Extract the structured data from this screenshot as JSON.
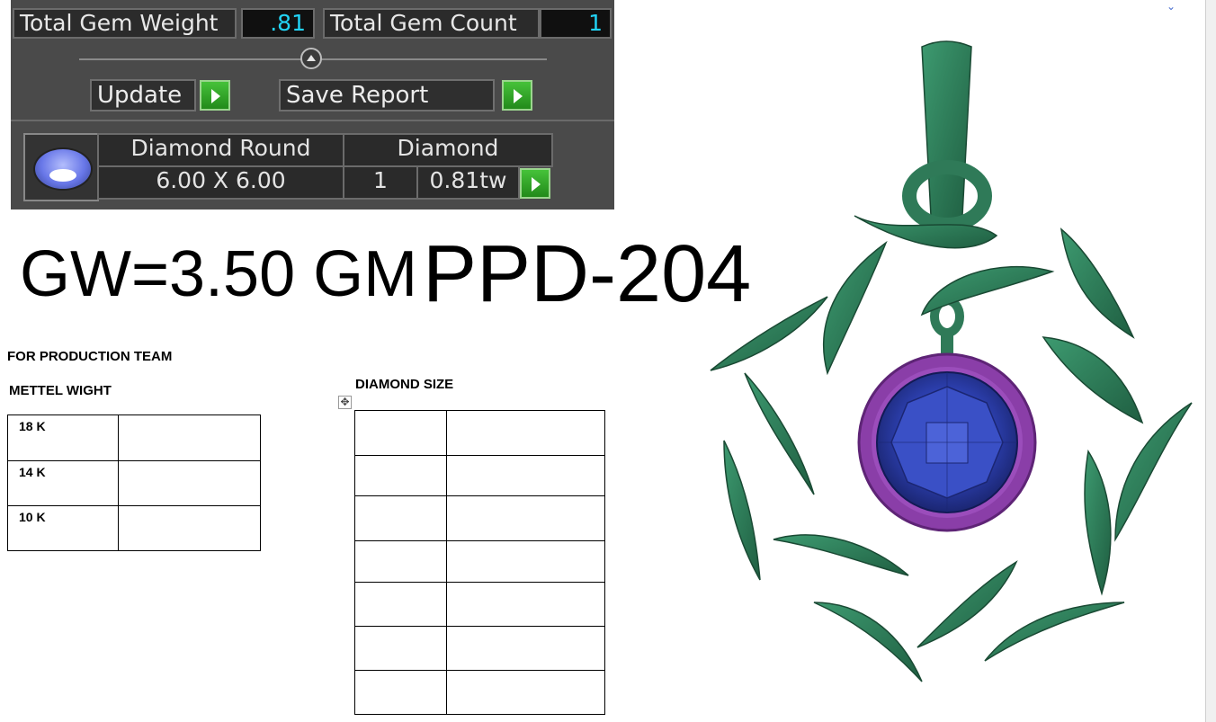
{
  "gem_panel": {
    "total_gem_weight_label": "Total Gem Weight",
    "total_gem_weight_value": ".81",
    "total_gem_count_label": "Total Gem Count",
    "total_gem_count_value": "1",
    "update_label": "Update",
    "save_report_label": "Save Report",
    "gem_row": {
      "shape": "Diamond Round",
      "material": "Diamond",
      "size": "6.00 X 6.00",
      "count": "1",
      "weight": "0.81tw"
    }
  },
  "headline": {
    "gross_weight": "GW=3.50 GM",
    "design_code": "PPD-204"
  },
  "production": {
    "title": "FOR PRODUCTION TEAM",
    "metal_heading": "METTEL WIGHT",
    "metal_rows": [
      "18 K",
      "14 K",
      "10 K"
    ],
    "diamond_heading": "DIAMOND SIZE"
  },
  "colors": {
    "metal_green": "#2f7a58",
    "setting_purple": "#8a3ea8",
    "stone_blue": "#2c3fae",
    "accent_button": "#2ea02a"
  }
}
